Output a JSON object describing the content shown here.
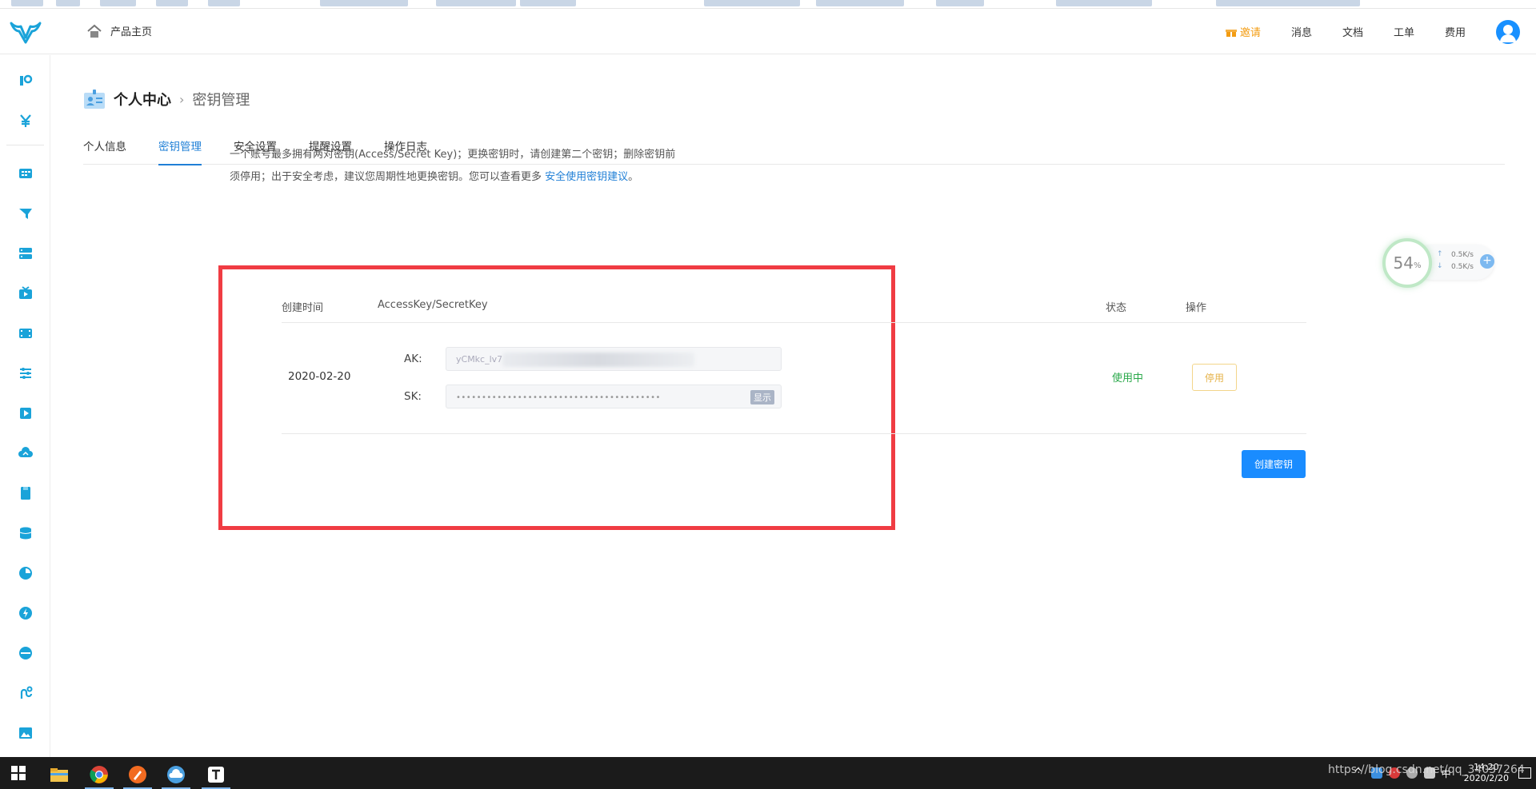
{
  "header": {
    "home_label": "产品主页",
    "invite_label": "邀请",
    "nav": [
      "消息",
      "文档",
      "工单",
      "费用"
    ]
  },
  "breadcrumb": {
    "title": "个人中心",
    "separator": "›",
    "current": "密钥管理"
  },
  "tabs": [
    {
      "label": "个人信息",
      "active": false
    },
    {
      "label": "密钥管理",
      "active": true
    },
    {
      "label": "安全设置",
      "active": false
    },
    {
      "label": "提醒设置",
      "active": false
    },
    {
      "label": "操作日志",
      "active": false
    }
  ],
  "notice": {
    "text": "一个账号最多拥有两对密钥(Access/Secret Key)；更换密钥时，请创建第二个密钥；删除密钥前须停用；出于安全考虑，建议您周期性地更换密钥。您可以查看更多 ",
    "link": "安全使用密钥建议",
    "suffix": "。"
  },
  "table": {
    "headers": {
      "created": "创建时间",
      "keys": "AccessKey/SecretKey",
      "status": "状态",
      "action": "操作"
    },
    "rows": [
      {
        "created": "2020-02-20",
        "ak_label": "AK:",
        "ak_value": "yCMkc_lv7",
        "sk_label": "SK:",
        "sk_value": "••••••••••••••••••••••••••••••••••••••••",
        "show_label": "显示",
        "status": "使用中",
        "action": "停用"
      }
    ]
  },
  "create_button": "创建密钥",
  "speed_widget": {
    "percent": "54",
    "unit": "%",
    "up": "0.5K/s",
    "down": "0.5K/s",
    "up_arrow": "↑",
    "down_arrow": "↓",
    "plus": "+"
  },
  "taskbar": {
    "time": "14:20",
    "date": "2020/2/20",
    "ime": "中",
    "watermark": "https://blog.csdn.net/qq_34037264"
  },
  "colors": {
    "primary": "#1a8cff",
    "link": "#1f7fd6",
    "highlight": "#f03c43",
    "status_active": "#2aa84a",
    "disable_border": "#f3d58a"
  }
}
